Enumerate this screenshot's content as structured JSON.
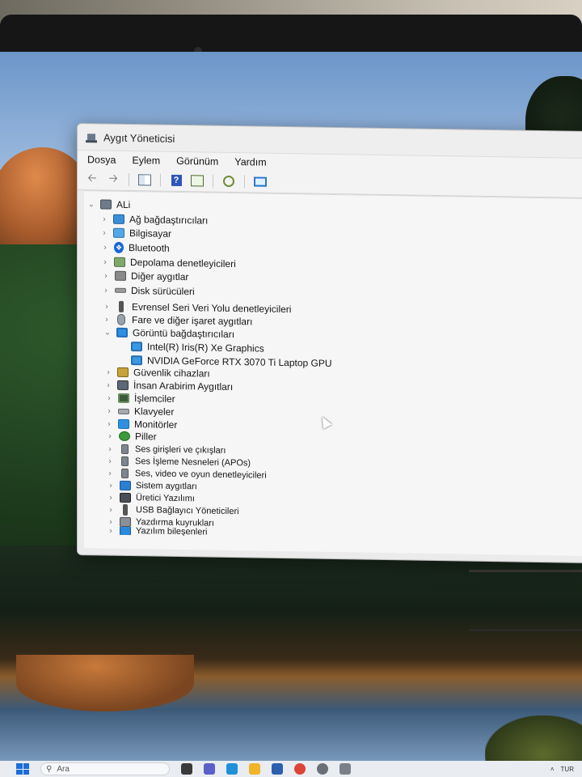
{
  "window": {
    "title": "Aygıt Yöneticisi"
  },
  "menu": [
    "Dosya",
    "Eylem",
    "Görünüm",
    "Yardım"
  ],
  "toolbar": {
    "icons": [
      "back-arrow-icon",
      "forward-arrow-icon",
      "grid-view-icon",
      "help-icon",
      "properties-icon",
      "scan-hardware-icon",
      "monitor-icon"
    ]
  },
  "tree": {
    "root": "ALi",
    "categories": [
      {
        "label": "Ağ bağdaştırıcıları",
        "icon": "network-adapter-icon",
        "expanded": false
      },
      {
        "label": "Bilgisayar",
        "icon": "computer-icon",
        "expanded": false
      },
      {
        "label": "Bluetooth",
        "icon": "bluetooth-icon",
        "expanded": false
      },
      {
        "label": "Depolama denetleyicileri",
        "icon": "storage-controller-icon",
        "expanded": false
      },
      {
        "label": "Diğer aygıtlar",
        "icon": "other-devices-icon",
        "expanded": false
      },
      {
        "label": "Disk sürücüleri",
        "icon": "disk-drive-icon",
        "expanded": false
      },
      {
        "label": "Evrensel Seri Veri Yolu denetleyicileri",
        "icon": "usb-controller-icon",
        "expanded": false
      },
      {
        "label": "Fare ve diğer işaret aygıtları",
        "icon": "mouse-icon",
        "expanded": false
      },
      {
        "label": "Görüntü bağdaştırıcıları",
        "icon": "display-adapter-icon",
        "expanded": true,
        "children": [
          "Intel(R) Iris(R) Xe Graphics",
          "NVIDIA GeForce RTX 3070 Ti Laptop GPU"
        ]
      },
      {
        "label": "Güvenlik cihazları",
        "icon": "security-device-icon",
        "expanded": false
      },
      {
        "label": "İnsan Arabirim Aygıtları",
        "icon": "hid-icon",
        "expanded": false
      },
      {
        "label": "İşlemciler",
        "icon": "processor-icon",
        "expanded": false
      },
      {
        "label": "Klavyeler",
        "icon": "keyboard-icon",
        "expanded": false
      },
      {
        "label": "Monitörler",
        "icon": "monitor-icon",
        "expanded": false
      },
      {
        "label": "Piller",
        "icon": "battery-icon",
        "expanded": false
      },
      {
        "label": "Ses girişleri ve çıkışları",
        "icon": "audio-io-icon",
        "expanded": false
      },
      {
        "label": "Ses İşleme Nesneleri (APOs)",
        "icon": "audio-apo-icon",
        "expanded": false
      },
      {
        "label": "Ses, video ve oyun denetleyicileri",
        "icon": "sound-video-icon",
        "expanded": false
      },
      {
        "label": "Sistem aygıtları",
        "icon": "system-devices-icon",
        "expanded": false
      },
      {
        "label": "Üretici Yazılımı",
        "icon": "firmware-icon",
        "expanded": false
      },
      {
        "label": "USB Bağlayıcı Yöneticileri",
        "icon": "usb-connector-icon",
        "expanded": false
      },
      {
        "label": "Yazdırma kuyrukları",
        "icon": "print-queue-icon",
        "expanded": false
      },
      {
        "label": "Yazılım bileşenleri",
        "icon": "software-components-icon",
        "expanded": false
      }
    ]
  },
  "taskbar": {
    "search_placeholder": "Ara",
    "tray_text": "TUR"
  }
}
